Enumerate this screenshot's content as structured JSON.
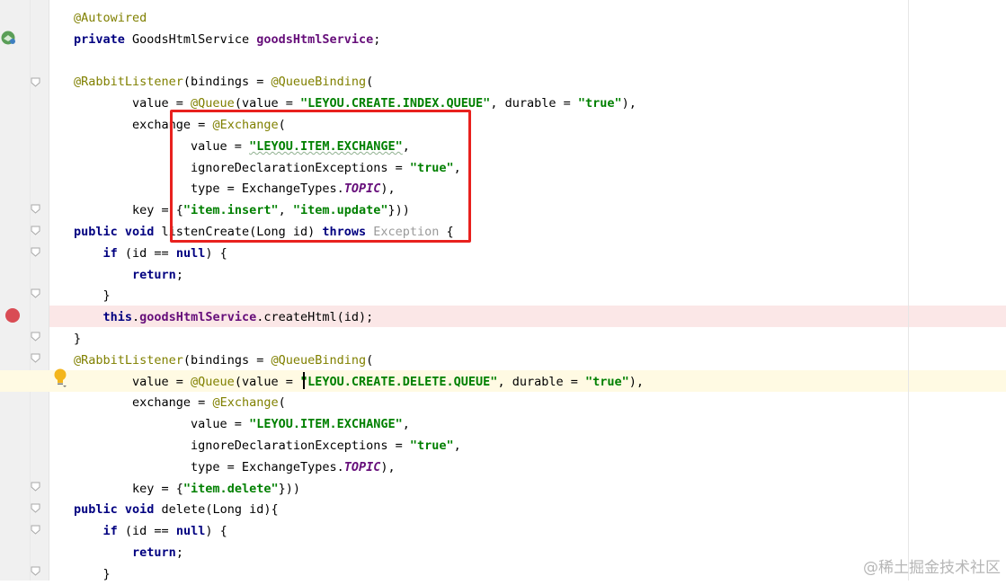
{
  "editor": {
    "lines": [
      [
        {
          "t": "@Autowired",
          "c": "ann"
        }
      ],
      [
        {
          "t": "private ",
          "c": "kw"
        },
        {
          "t": "GoodsHtmlService "
        },
        {
          "t": "goodsHtmlService",
          "c": "fld"
        },
        {
          "t": ";"
        }
      ],
      [],
      [
        {
          "t": "@RabbitListener",
          "c": "ann"
        },
        {
          "t": "(bindings = "
        },
        {
          "t": "@QueueBinding",
          "c": "ann"
        },
        {
          "t": "("
        }
      ],
      [
        {
          "t": "        value = "
        },
        {
          "t": "@Queue",
          "c": "ann"
        },
        {
          "t": "(value = "
        },
        {
          "t": "\"LEYOU.CREATE.INDEX.QUEUE\"",
          "c": "str"
        },
        {
          "t": ", durable = "
        },
        {
          "t": "\"true\"",
          "c": "str"
        },
        {
          "t": "),"
        }
      ],
      [
        {
          "t": "        exchange = "
        },
        {
          "t": "@Exchange",
          "c": "ann"
        },
        {
          "t": "("
        }
      ],
      [
        {
          "t": "                value = "
        },
        {
          "t": "\"LEYOU.ITEM.EXCHANGE\"",
          "c": "str"
        },
        {
          "t": ","
        }
      ],
      [
        {
          "t": "                ignoreDeclarationExceptions = "
        },
        {
          "t": "\"true\"",
          "c": "str"
        },
        {
          "t": ","
        }
      ],
      [
        {
          "t": "                type = ExchangeTypes."
        },
        {
          "t": "TOPIC",
          "c": "cst"
        },
        {
          "t": "),"
        }
      ],
      [
        {
          "t": "        key = {"
        },
        {
          "t": "\"item.insert\"",
          "c": "str"
        },
        {
          "t": ", "
        },
        {
          "t": "\"item.update\"",
          "c": "str"
        },
        {
          "t": "}))"
        }
      ],
      [
        {
          "t": "public void ",
          "c": "kw"
        },
        {
          "t": "listenCreate(Long id) "
        },
        {
          "t": "throws ",
          "c": "kw"
        },
        {
          "t": "Exception",
          "c": "gray"
        },
        {
          "t": " {"
        }
      ],
      [
        {
          "t": "    "
        },
        {
          "t": "if ",
          "c": "kw"
        },
        {
          "t": "(id == "
        },
        {
          "t": "null",
          "c": "kw"
        },
        {
          "t": ") {"
        }
      ],
      [
        {
          "t": "        "
        },
        {
          "t": "return",
          "c": "kw"
        },
        {
          "t": ";"
        }
      ],
      [
        {
          "t": "    }"
        }
      ],
      [
        {
          "t": "    "
        },
        {
          "t": "this",
          "c": "kw"
        },
        {
          "t": "."
        },
        {
          "t": "goodsHtmlService",
          "c": "fld"
        },
        {
          "t": ".createHtml(id);"
        }
      ],
      [
        {
          "t": "}"
        }
      ],
      [
        {
          "t": "@RabbitListener",
          "c": "ann"
        },
        {
          "t": "(bindings = "
        },
        {
          "t": "@QueueBinding",
          "c": "ann"
        },
        {
          "t": "("
        }
      ],
      [
        {
          "t": "        value = "
        },
        {
          "t": "@Queue",
          "c": "ann"
        },
        {
          "t": "(value = "
        },
        {
          "t": "\"LEYOU.CREATE.DELETE.QUEUE\"",
          "c": "str"
        },
        {
          "t": ", durable = "
        },
        {
          "t": "\"true\"",
          "c": "str"
        },
        {
          "t": "),"
        }
      ],
      [
        {
          "t": "        exchange = "
        },
        {
          "t": "@Exchange",
          "c": "ann"
        },
        {
          "t": "("
        }
      ],
      [
        {
          "t": "                value = "
        },
        {
          "t": "\"LEYOU.ITEM.EXCHANGE\"",
          "c": "str"
        },
        {
          "t": ","
        }
      ],
      [
        {
          "t": "                ignoreDeclarationExceptions = "
        },
        {
          "t": "\"true\"",
          "c": "str"
        },
        {
          "t": ","
        }
      ],
      [
        {
          "t": "                type = ExchangeTypes."
        },
        {
          "t": "TOPIC",
          "c": "cst"
        },
        {
          "t": "),"
        }
      ],
      [
        {
          "t": "        key = {"
        },
        {
          "t": "\"item.delete\"",
          "c": "str"
        },
        {
          "t": "}))"
        }
      ],
      [
        {
          "t": "public void ",
          "c": "kw"
        },
        {
          "t": "delete(Long id){"
        }
      ],
      [
        {
          "t": "    "
        },
        {
          "t": "if ",
          "c": "kw"
        },
        {
          "t": "(id == "
        },
        {
          "t": "null",
          "c": "kw"
        },
        {
          "t": ") {"
        }
      ],
      [
        {
          "t": "        "
        },
        {
          "t": "return",
          "c": "kw"
        },
        {
          "t": ";"
        }
      ],
      [
        {
          "t": "    }"
        }
      ]
    ],
    "breakpoint_line": 15,
    "caret_line": 18,
    "highlighted_block_lines": [
      6,
      10
    ]
  },
  "colors": {
    "annotation": "#808000",
    "keyword": "#000080",
    "string": "#008000",
    "field": "#660e7a",
    "breakpoint": "#d94c54",
    "highlight_box": "#e8211e"
  },
  "icons": {
    "gutter_run": "rabbit-listener-gutter-icon",
    "breakpoint": "breakpoint-icon",
    "intention": "lightbulb-icon",
    "fold": "fold-marker-icon"
  },
  "watermark": "@稀土掘金技术社区"
}
